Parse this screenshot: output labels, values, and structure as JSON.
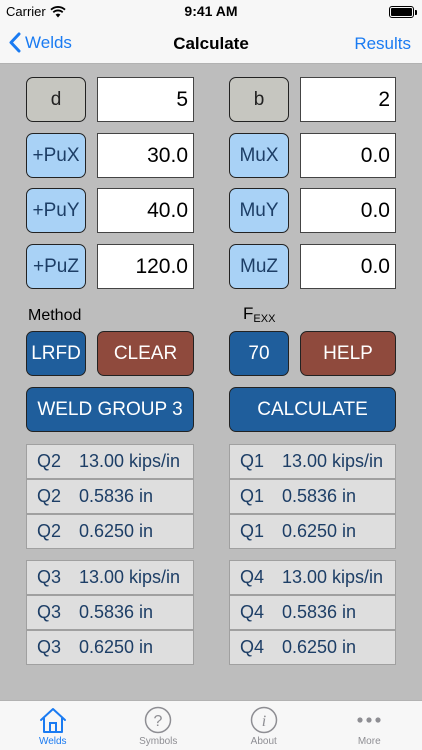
{
  "status": {
    "carrier": "Carrier",
    "time": "9:41 AM"
  },
  "nav": {
    "back": "Welds",
    "title": "Calculate",
    "right": "Results"
  },
  "inputs": [
    {
      "label": "d",
      "value": "5",
      "style": "gray"
    },
    {
      "label": "b",
      "value": "2",
      "style": "gray"
    },
    {
      "label": "+PuX",
      "value": "30.0",
      "style": "light"
    },
    {
      "label": "MuX",
      "value": "0.0",
      "style": "light"
    },
    {
      "label": "+PuY",
      "value": "40.0",
      "style": "light"
    },
    {
      "label": "MuY",
      "value": "0.0",
      "style": "light"
    },
    {
      "label": "+PuZ",
      "value": "120.0",
      "style": "light"
    },
    {
      "label": "MuZ",
      "value": "0.0",
      "style": "light"
    }
  ],
  "method": {
    "label": "Method",
    "value": "LRFD"
  },
  "fexx": {
    "base": "F",
    "sub": "EXX",
    "value": "70"
  },
  "buttons": {
    "clear": "CLEAR",
    "help": "HELP",
    "weld_group": "WELD GROUP 3",
    "calculate": "CALCULATE"
  },
  "results": [
    {
      "q": "Q2",
      "v": "13.00 kips/in"
    },
    {
      "q": "Q1",
      "v": "13.00 kips/in"
    },
    {
      "q": "Q2",
      "v": "0.5836 in"
    },
    {
      "q": "Q1",
      "v": "0.5836 in"
    },
    {
      "q": "Q2",
      "v": "0.6250 in"
    },
    {
      "q": "Q1",
      "v": "0.6250 in"
    },
    {
      "q": "Q3",
      "v": "13.00 kips/in"
    },
    {
      "q": "Q4",
      "v": "13.00 kips/in"
    },
    {
      "q": "Q3",
      "v": "0.5836 in"
    },
    {
      "q": "Q4",
      "v": "0.5836 in"
    },
    {
      "q": "Q3",
      "v": "0.6250 in"
    },
    {
      "q": "Q4",
      "v": "0.6250 in"
    }
  ],
  "tabs": [
    {
      "label": "Welds",
      "icon": "house-icon",
      "active": true
    },
    {
      "label": "Symbols",
      "icon": "question-icon",
      "active": false
    },
    {
      "label": "About",
      "icon": "info-icon",
      "active": false
    },
    {
      "label": "More",
      "icon": "more-icon",
      "active": false
    }
  ],
  "colors": {
    "accent": "#1a7bf2",
    "dark_button": "#1f5e9c",
    "light_button": "#a9d2f6",
    "red_button": "#8f4a3d"
  }
}
